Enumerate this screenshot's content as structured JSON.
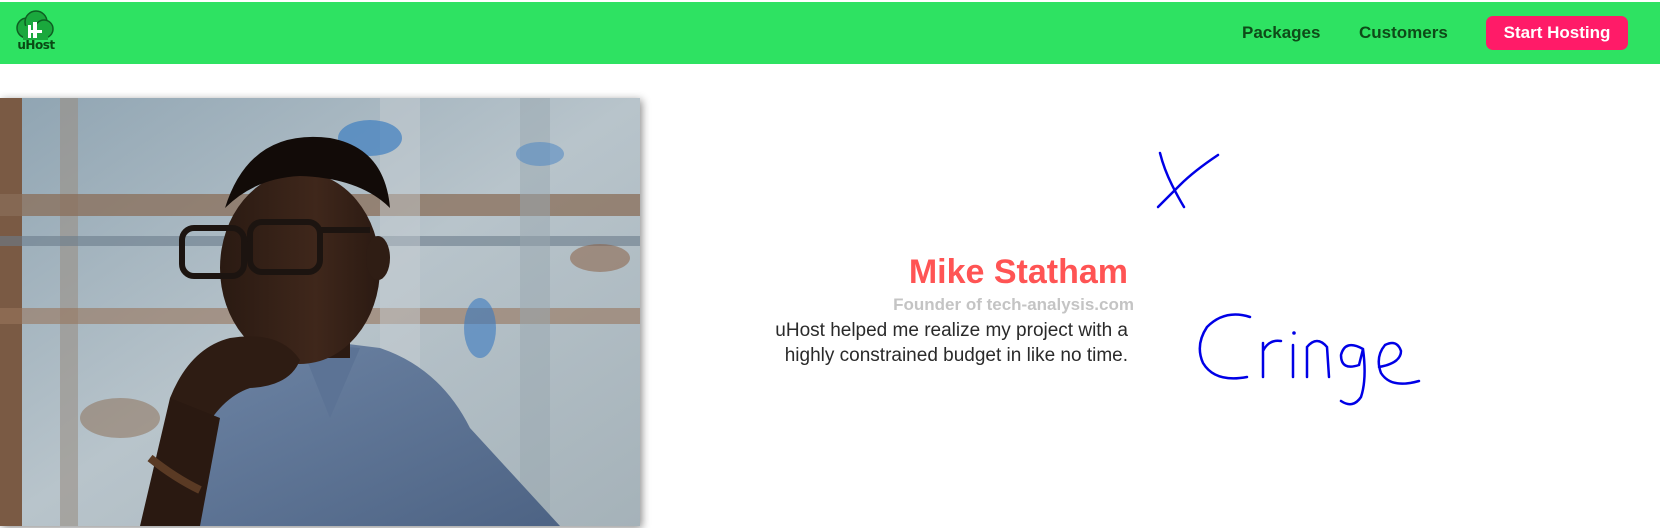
{
  "header": {
    "logo_text": "uHost",
    "nav": {
      "packages": "Packages",
      "customers": "Customers"
    },
    "cta_label": "Start Hosting",
    "colors": {
      "background": "#2ee262",
      "link": "#0e4a18",
      "cta": "#ff1b68"
    }
  },
  "testimonial": {
    "name": "Mike Statham",
    "role": "Founder of tech-analysis.com",
    "quote_lines": [
      "uHost helped me realize my project with a",
      "highly constrained budget in like no time."
    ],
    "photo": "customer-portrait",
    "colors": {
      "name": "#ff5454",
      "role": "#c4c4c4",
      "quote": "#2a2a2a"
    }
  },
  "annotations": {
    "mark": "X",
    "word": "Cringe",
    "ink_color": "#0000e6"
  }
}
